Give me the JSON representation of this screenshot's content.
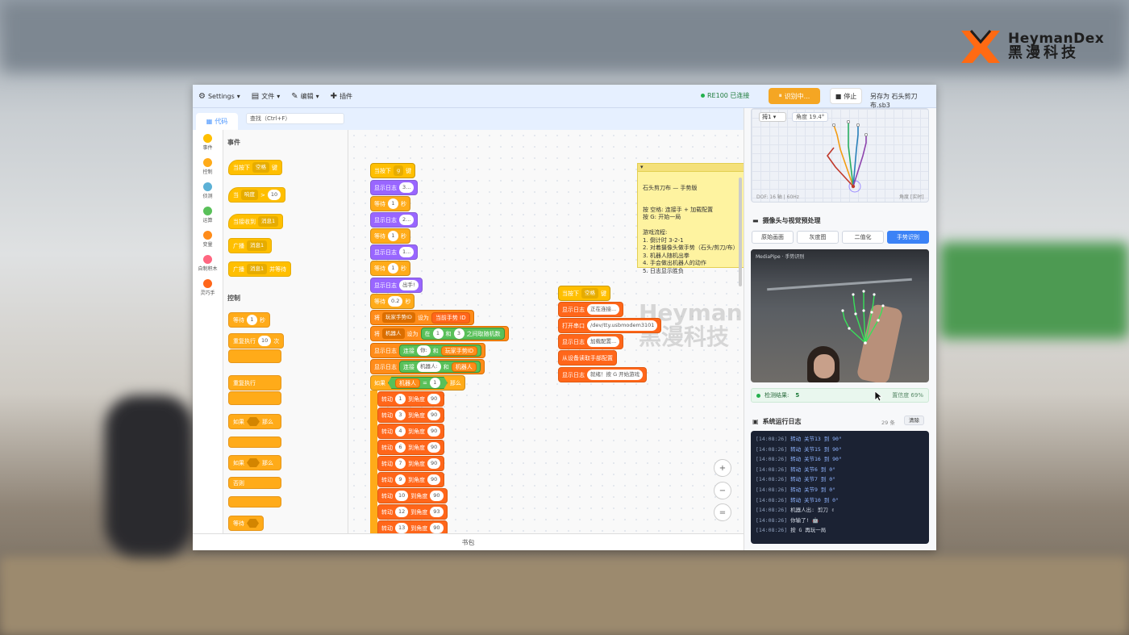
{
  "brand": {
    "en": "HeymanDex",
    "cn": "黑漫科技",
    "color": "#ff6a13"
  },
  "menubar": {
    "items": [
      {
        "label": "Settings",
        "icon": "gear-icon"
      },
      {
        "label": "文件",
        "icon": "file-icon"
      },
      {
        "label": "编辑",
        "icon": "edit-icon"
      },
      {
        "label": "插件",
        "icon": "puzzle-icon"
      }
    ],
    "connection": "RE100 已连接",
    "recognize_button": "识别中...",
    "stop_button": "停止",
    "save_as": "另存为 石头剪刀布.sb3"
  },
  "tabs": {
    "code": "代码"
  },
  "search": {
    "placeholder": "查找（Ctrl+F）"
  },
  "categories": [
    {
      "label": "事件",
      "color": "#ffbf00"
    },
    {
      "label": "控制",
      "color": "#ffab19"
    },
    {
      "label": "侦测",
      "color": "#5cb1d6"
    },
    {
      "label": "运算",
      "color": "#59c059"
    },
    {
      "label": "变量",
      "color": "#ff8c1a"
    },
    {
      "label": "自制积木",
      "color": "#ff6680"
    },
    {
      "label": "灵巧手",
      "color": "#ff661a"
    }
  ],
  "palette": {
    "events_title": "事件",
    "control_title": "控制",
    "ev1": {
      "pre": "当按下",
      "dd": "空格",
      "post": "键"
    },
    "ev2": {
      "pre": "当",
      "dd": "响度",
      "op": ">",
      "val": "10"
    },
    "ev3": {
      "pre": "当接收到",
      "dd": "消息1"
    },
    "ev4": {
      "pre": "广播",
      "dd": "消息1"
    },
    "ev5": {
      "pre": "广播",
      "dd": "消息1",
      "post": "并等待"
    },
    "c1": {
      "pre": "等待",
      "val": "1",
      "post": "秒"
    },
    "c2": {
      "pre": "重复执行",
      "val": "10",
      "post": "次"
    },
    "c3": {
      "pre": "重复执行"
    },
    "c4": {
      "pre": "如果",
      "post": "那么"
    },
    "c5": {
      "pre": "如果",
      "post": "那么"
    },
    "c5else": "否则",
    "c6": {
      "pre": "等待"
    }
  },
  "script1": {
    "hat": {
      "pre": "当按下",
      "dd": "g",
      "post": "键"
    },
    "log1": {
      "pre": "显示日志",
      "val": "3..."
    },
    "wait1": {
      "pre": "等待",
      "val": "1",
      "post": "秒"
    },
    "log2": {
      "pre": "显示日志",
      "val": "2..."
    },
    "wait2": {
      "pre": "等待",
      "val": "1",
      "post": "秒"
    },
    "log3": {
      "pre": "显示日志",
      "val": "1..."
    },
    "wait3": {
      "pre": "等待",
      "val": "1",
      "post": "秒"
    },
    "log4": {
      "pre": "显示日志",
      "val": "出手!"
    },
    "wait4": {
      "pre": "等待",
      "val": "0.2",
      "post": "秒"
    },
    "set1": {
      "pre": "将",
      "var": "玩家手势ID",
      "mid": "设为",
      "val": "当前手势 ID"
    },
    "set2": {
      "pre": "将",
      "var": "机器人",
      "mid": "设为",
      "op": "在",
      "a": "1",
      "and": "和",
      "b": "3",
      "post": "之间取随机数"
    },
    "log5": {
      "pre": "显示日志",
      "join": "连接",
      "a": "你:",
      "and": "和",
      "b": "玩家手势ID"
    },
    "log6": {
      "pre": "显示日志",
      "join": "连接",
      "a": "机器人:",
      "and": "和",
      "b": "机器人"
    },
    "if1": {
      "pre": "如果",
      "var": "机器人",
      "op": "=",
      "val": "1",
      "post": "那么"
    },
    "turns": [
      {
        "pre": "转动",
        "j": "1",
        "mid": "到角度",
        "v": "90"
      },
      {
        "pre": "转动",
        "j": "3",
        "mid": "到角度",
        "v": "90"
      },
      {
        "pre": "转动",
        "j": "4",
        "mid": "到角度",
        "v": "90"
      },
      {
        "pre": "转动",
        "j": "6",
        "mid": "到角度",
        "v": "90"
      },
      {
        "pre": "转动",
        "j": "7",
        "mid": "到角度",
        "v": "90"
      },
      {
        "pre": "转动",
        "j": "9",
        "mid": "到角度",
        "v": "90"
      },
      {
        "pre": "转动",
        "j": "10",
        "mid": "到角度",
        "v": "90"
      },
      {
        "pre": "转动",
        "j": "12",
        "mid": "到角度",
        "v": "93"
      },
      {
        "pre": "转动",
        "j": "13",
        "mid": "到角度",
        "v": "90"
      }
    ]
  },
  "script2": {
    "hat": {
      "pre": "当按下",
      "dd": "空格",
      "post": "键"
    },
    "log1": {
      "pre": "显示日志",
      "val": "正在连接..."
    },
    "open": {
      "pre": "打开串口",
      "val": "/dev/tty.usbmodem3101"
    },
    "log2": {
      "pre": "显示日志",
      "val": "加载配置..."
    },
    "read": "从设备读取手部配置",
    "log3": {
      "pre": "显示日志",
      "val": "就绪！按 G 开始游戏"
    }
  },
  "note": {
    "title": "石头剪刀布 — 手势版",
    "body": "按 空格: 连接手 + 加载配置\n按 G: 开始一局\n\n游戏流程:\n1. 倒计时 3-2-1\n2. 对着摄像头做手势（石头/剪刀/布）\n3. 机器人随机出拳\n4. 手会做出机器人的动作\n5. 日志显示胜负"
  },
  "watermark": {
    "line1": "HeymanDex",
    "line2": "黑漫科技",
    "tm": "TM"
  },
  "zoom": {
    "in": "+",
    "out": "−",
    "reset": "="
  },
  "backpack": "书包",
  "side": {
    "hand_select": "拇1",
    "angle": "角度 19.4°",
    "dof": "DOF: 16 轴 | 60Hz",
    "angle_mode": "角度 [实时]",
    "camera_title": "摄像头与视觉预处理",
    "modes": [
      {
        "label": "原始画面",
        "active": false
      },
      {
        "label": "灰度图",
        "active": false
      },
      {
        "label": "二值化",
        "active": false
      },
      {
        "label": "手势识别",
        "active": true
      }
    ],
    "camera_caption": "MediaPipe · 手势识别",
    "detect_label": "检测结果:",
    "detect_value": "5",
    "confidence": "置信度 69%",
    "log_title": "系统运行日志",
    "log_count": "29 条",
    "clear": "清除",
    "log": [
      {
        "t": "[14:08:26]",
        "a": "转动 关节13 到 90°"
      },
      {
        "t": "[14:08:26]",
        "a": "转动 关节15 到 90°"
      },
      {
        "t": "[14:08:26]",
        "a": "转动 关节16 到 90°"
      },
      {
        "t": "[14:08:26]",
        "a": "转动 关节6 到 0°"
      },
      {
        "t": "[14:08:26]",
        "a": "转动 关节7 到 0°"
      },
      {
        "t": "[14:08:26]",
        "a": "转动 关节9 到 0°"
      },
      {
        "t": "[14:08:26]",
        "a": "转动 关节10 到 0°"
      },
      {
        "t": "[14:08:26]",
        "p": "机器人出: 剪刀 ✌"
      },
      {
        "t": "[14:08:26]",
        "p": "你输了! 🤖"
      },
      {
        "t": "[14:08:26]",
        "p": "按 G 再玩一局"
      }
    ]
  }
}
